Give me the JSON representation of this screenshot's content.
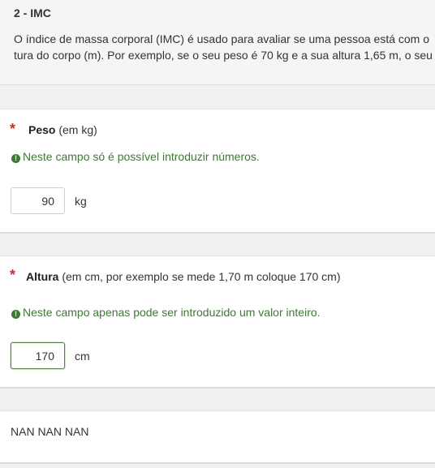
{
  "intro": {
    "title": "2 - IMC",
    "line1": "O índice de massa corporal (IMC) é usado para avaliar se uma pessoa está com o",
    "line2": "tura do corpo (m). Por exemplo, se o seu peso é 70 kg e a sua altura 1,65 m, o seu"
  },
  "weight": {
    "required_mark": "*",
    "label": "Peso",
    "label_note": " (em kg)",
    "tip": "Neste campo só é possível introduzir números.",
    "value": "90",
    "unit": "kg"
  },
  "height": {
    "required_mark": "*",
    "label": "Altura",
    "label_note": " (em cm, por exemplo se mede 1,70 m coloque 170 cm)",
    "tip": "Neste campo apenas pode ser introduzido um valor inteiro.",
    "value": "170",
    "unit": "cm"
  },
  "result": {
    "text": "NAN NAN NAN"
  },
  "colors": {
    "required": "#c9302c",
    "tip": "#3c7a32",
    "focus_border": "#4a8a3f"
  },
  "icons": {
    "tip": "exclamation-circle-icon"
  }
}
